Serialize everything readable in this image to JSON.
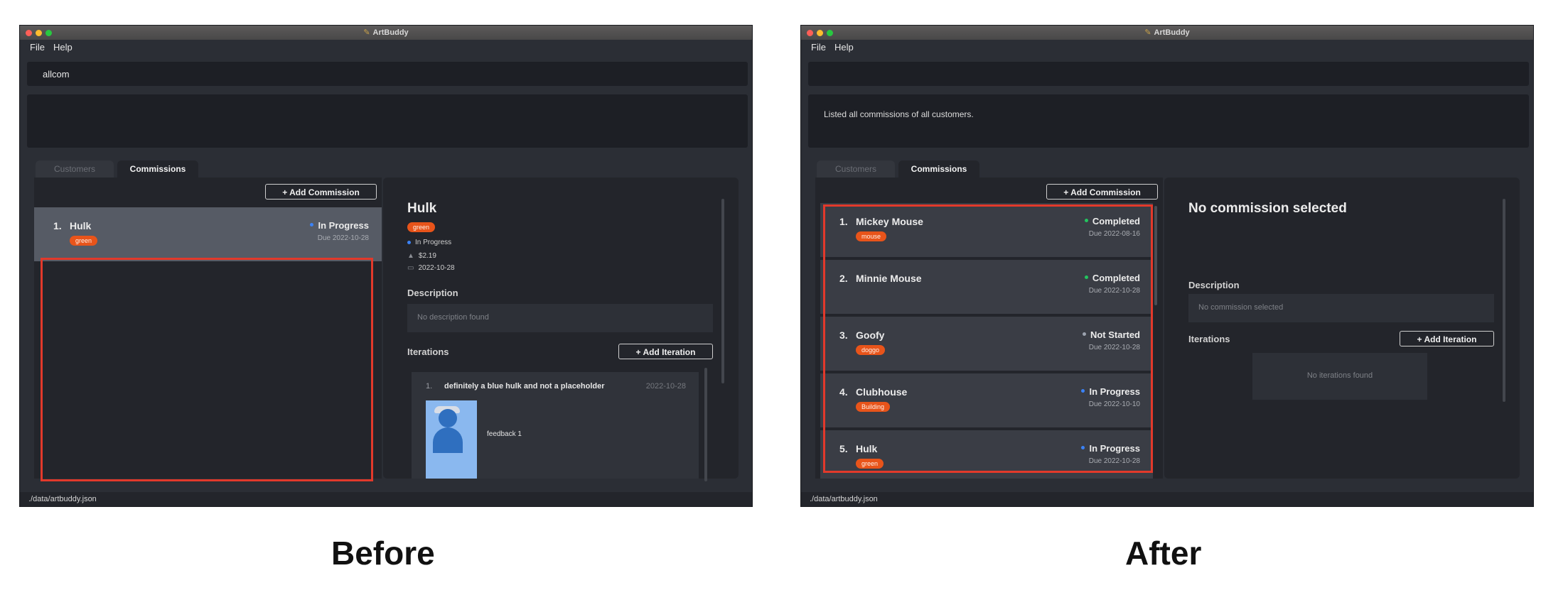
{
  "app": {
    "title": "ArtBuddy",
    "icon": "palette-icon",
    "menu": [
      "File",
      "Help"
    ]
  },
  "before": {
    "caption": "Before",
    "command_text": "allcom",
    "result_text": "",
    "tabs": [
      "Customers",
      "Commissions"
    ],
    "add_commission_label": "+ Add Commission",
    "commissions": [
      {
        "index": "1.",
        "name": "Hulk",
        "tag": "green",
        "status": "In Progress",
        "status_color": "#3b82f6",
        "due": "Due 2022-10-28"
      }
    ],
    "detail": {
      "title": "Hulk",
      "tag": "green",
      "status": "In Progress",
      "fee": "$2.19",
      "date": "2022-10-28",
      "description_label": "Description",
      "description_text": "No description found",
      "iterations_label": "Iterations",
      "add_iteration_label": "+ Add Iteration",
      "iteration": {
        "index": "1.",
        "title": "definitely a blue hulk and not a placeholder",
        "date": "2022-10-28",
        "feedback": "feedback 1"
      }
    },
    "status_bar": "./data/artbuddy.json"
  },
  "after": {
    "caption": "After",
    "command_text": "",
    "result_text": "Listed all commissions of all customers.",
    "tabs": [
      "Customers",
      "Commissions"
    ],
    "add_commission_label": "+ Add Commission",
    "commissions": [
      {
        "index": "1.",
        "name": "Mickey Mouse",
        "tag": "mouse",
        "status": "Completed",
        "status_color": "#22c55e",
        "due": "Due 2022-08-16"
      },
      {
        "index": "2.",
        "name": "Minnie Mouse",
        "tag": "",
        "status": "Completed",
        "status_color": "#22c55e",
        "due": "Due 2022-10-28"
      },
      {
        "index": "3.",
        "name": "Goofy",
        "tag": "doggo",
        "status": "Not Started",
        "status_color": "#9ca3af",
        "due": "Due 2022-10-28"
      },
      {
        "index": "4.",
        "name": "Clubhouse",
        "tag": "Building",
        "status": "In Progress",
        "status_color": "#3b82f6",
        "due": "Due 2022-10-10"
      },
      {
        "index": "5.",
        "name": "Hulk",
        "tag": "green",
        "status": "In Progress",
        "status_color": "#3b82f6",
        "due": "Due 2022-10-28"
      }
    ],
    "detail": {
      "title": "No commission selected",
      "description_label": "Description",
      "description_text": "No commission selected",
      "iterations_label": "Iterations",
      "add_iteration_label": "+ Add Iteration",
      "no_iterations_text": "No iterations found"
    },
    "status_bar": "./data/artbuddy.json"
  }
}
